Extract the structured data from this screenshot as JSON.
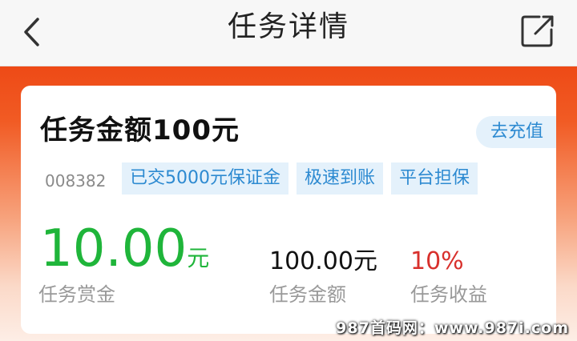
{
  "header": {
    "title": "任务详情"
  },
  "icons": {
    "back": "chevron-left-icon",
    "share": "share-icon"
  },
  "task": {
    "title": "任务金额100元",
    "recharge_label": "去充值",
    "id": "008382",
    "tags": [
      "已交5000元保证金",
      "极速到账",
      "平台担保"
    ],
    "reward_value": "10.00",
    "reward_unit": "元",
    "reward_label": "任务赏金",
    "amount_value": "100.00元",
    "amount_label": "任务金额",
    "yield_value": "10%",
    "yield_label": "任务收益"
  },
  "watermark": "987首码网：www.987i.com",
  "colors": {
    "accent_orange": "#ee4a16",
    "reward_green": "#1fb53a",
    "tag_blue": "#2d8ad1",
    "tag_bg": "#e4f1fb",
    "yield_red": "#d8302c"
  }
}
